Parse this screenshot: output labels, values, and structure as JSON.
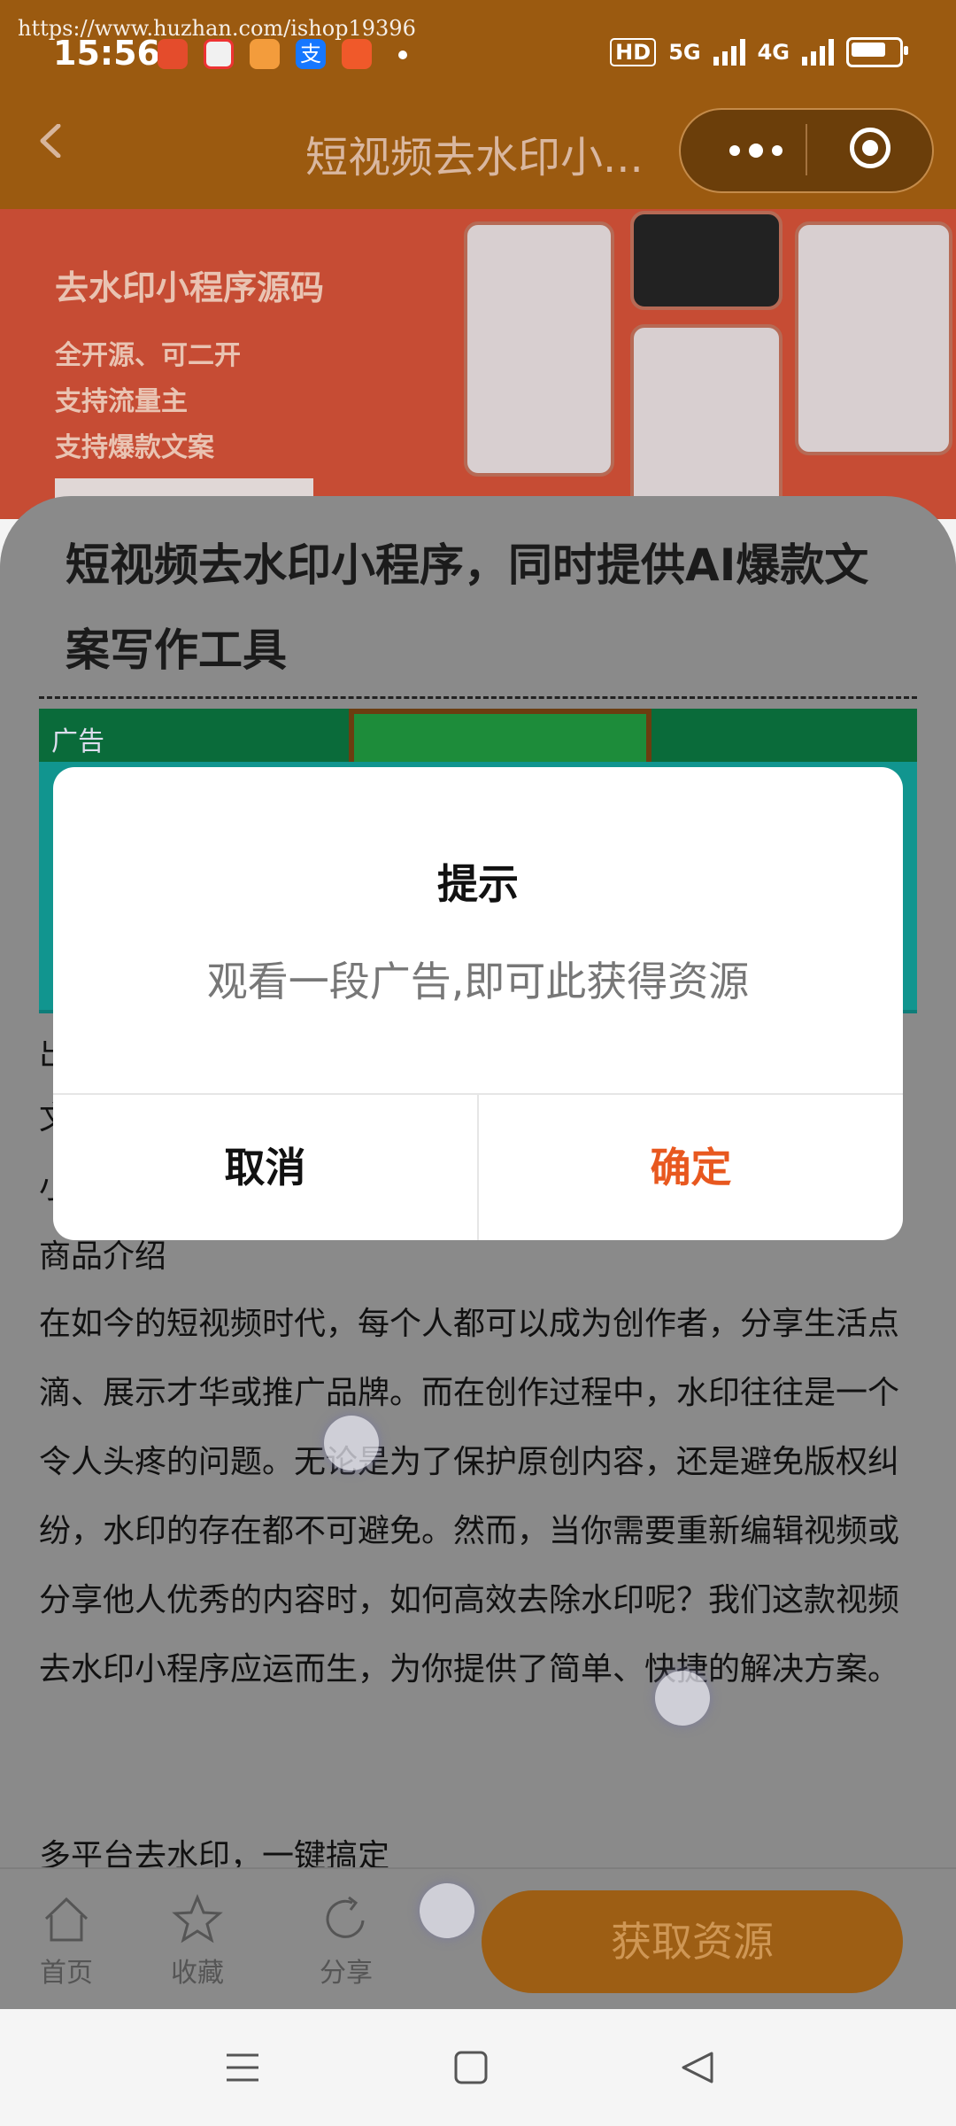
{
  "status_bar": {
    "watermark": "https://www.huzhan.com/ishop19396",
    "time": "15:56",
    "hd": "HD",
    "network1": "5G",
    "network2": "4G"
  },
  "nav": {
    "title": "短视频去水印小..."
  },
  "banner": {
    "headline": "去水印小程序源码",
    "lines": [
      "全开源、可二开",
      "支持流量主",
      "支持爆款文案"
    ]
  },
  "card": {
    "title": "短视频去水印小程序，同时提供AI爆款文案写作工具",
    "ad_tag": "广告"
  },
  "content": {
    "partial_lines": [
      "出",
      "文",
      "小"
    ],
    "section_heading": "商品介绍",
    "paragraph": "在如今的短视频时代，每个人都可以成为创作者，分享生活点滴、展示才华或推广品牌。而在创作过程中，水印往往是一个令人头疼的问题。无论是为了保护原创内容，还是避免版权纠纷，水印的存在都不可避免。然而，当你需要重新编辑视频或分享他人优秀的内容时，如何高效去除水印呢？我们这款视频去水印小程序应运而生，为你提供了简单、快捷的解决方案。",
    "cut_line": "多平台去水印，一键搞定"
  },
  "bottom_bar": {
    "home": "首页",
    "favorite": "收藏",
    "share": "分享",
    "get_resource": "获取资源"
  },
  "dialog": {
    "title": "提示",
    "message": "观看一段广告,即可此获得资源",
    "cancel": "取消",
    "confirm": "确定"
  },
  "colors": {
    "accent": "#e8581f",
    "nav_bg": "#9b5a10"
  }
}
